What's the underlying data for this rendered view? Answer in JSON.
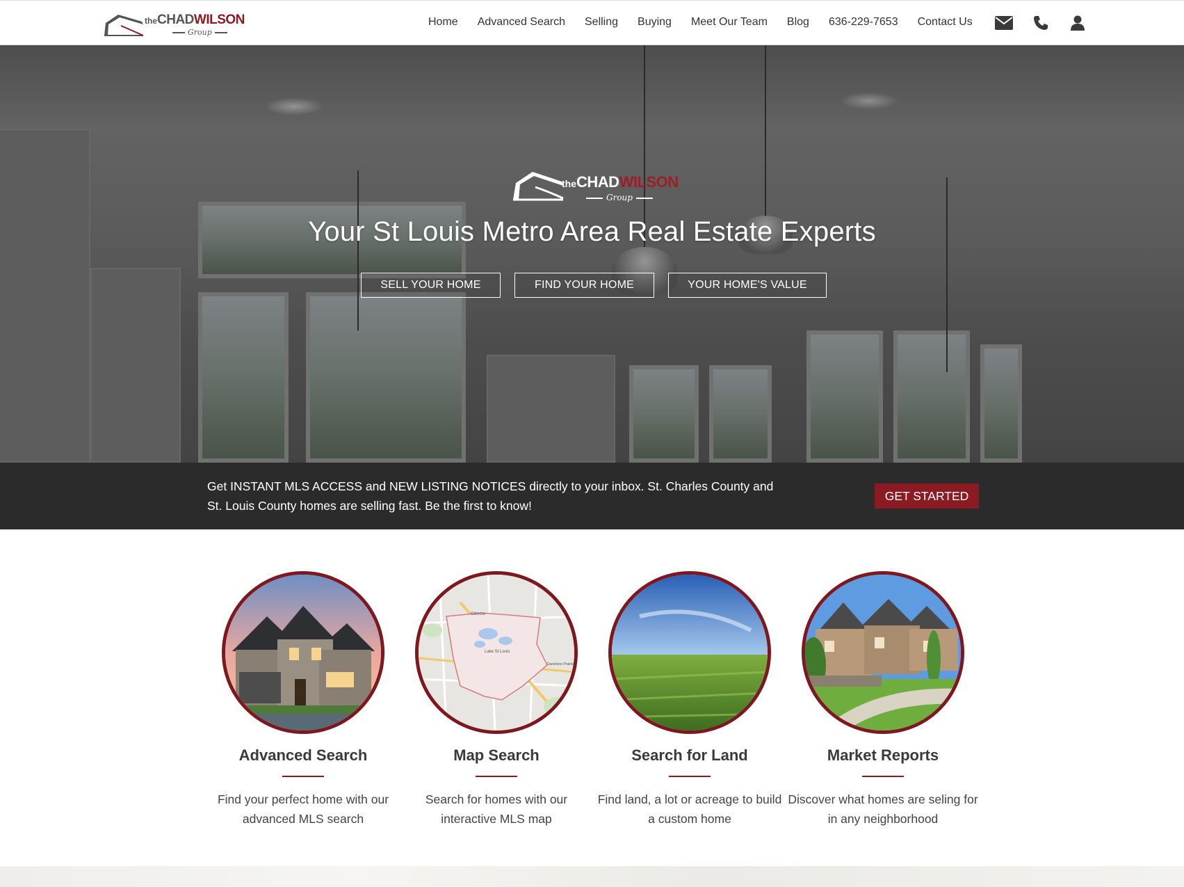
{
  "brand": {
    "the": "the",
    "chad": "CHAD",
    "wilson": "WILSON",
    "group": "Group",
    "accent_color": "#8b1a22"
  },
  "nav": {
    "links": [
      "Home",
      "Advanced Search",
      "Selling",
      "Buying",
      "Meet Our Team",
      "Blog",
      "636-229-7653",
      "Contact Us"
    ],
    "icons": [
      "envelope-icon",
      "phone-icon",
      "user-icon"
    ]
  },
  "hero": {
    "title": "Your St Louis Metro Area Real Estate Experts",
    "buttons": [
      "SELL YOUR HOME",
      "FIND YOUR HOME",
      "YOUR HOME'S VALUE"
    ]
  },
  "mls": {
    "text": "Get INSTANT MLS ACCESS and NEW LISTING NOTICES directly to your inbox. St. Charles County and St. Louis County homes are selling fast. Be the first to know!",
    "button": "GET STARTED"
  },
  "features": [
    {
      "title": "Advanced Search",
      "desc": "Find your perfect home with our advanced MLS search"
    },
    {
      "title": "Map Search",
      "desc": "Search for homes with our interactive MLS map"
    },
    {
      "title": "Search for Land",
      "desc": "Find land, a lot or acreage to build a custom home"
    },
    {
      "title": "Market Reports",
      "desc": "Discover what homes are seling for in any neighborhood"
    }
  ],
  "map_labels": [
    "Gilmore",
    "Lake St Louis",
    "Dardenne Prairie"
  ]
}
